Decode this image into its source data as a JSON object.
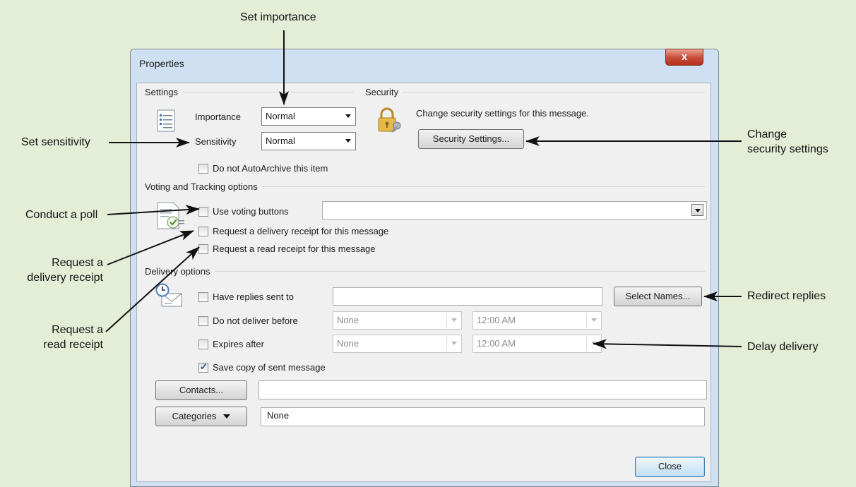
{
  "callouts": {
    "set_importance": "Set importance",
    "set_sensitivity": "Set sensitivity",
    "conduct_poll": "Conduct a poll",
    "request_delivery_1": "Request a",
    "request_delivery_2": "delivery receipt",
    "request_read_1": "Request a",
    "request_read_2": "read receipt",
    "change_security_1": "Change",
    "change_security_2": "security settings",
    "redirect_replies": "Redirect replies",
    "delay_delivery": "Delay delivery"
  },
  "dialog": {
    "title": "Properties",
    "close_glyph": "x"
  },
  "settings": {
    "group_label": "Settings",
    "importance_label": "Importance",
    "importance_value": "Normal",
    "sensitivity_label": "Sensitivity",
    "sensitivity_value": "Normal",
    "autoarchive_label": "Do not AutoArchive this item"
  },
  "security": {
    "group_label": "Security",
    "description": "Change security settings for this message.",
    "button_label": "Security Settings..."
  },
  "voting": {
    "group_label": "Voting and Tracking options",
    "use_voting_label": "Use voting buttons",
    "voting_value": "",
    "delivery_receipt_label": "Request a delivery receipt for this message",
    "read_receipt_label": "Request a read receipt for this message"
  },
  "delivery": {
    "group_label": "Delivery options",
    "have_replies_label": "Have replies sent to",
    "have_replies_value": "",
    "select_names_label": "Select Names...",
    "do_not_deliver_label": "Do not deliver before",
    "do_not_deliver_date": "None",
    "do_not_deliver_time": "12:00 AM",
    "expires_label": "Expires after",
    "expires_date": "None",
    "expires_time": "12:00 AM",
    "save_copy_label": "Save copy of sent message",
    "save_copy_checked": true
  },
  "contacts": {
    "button_label": "Contacts...",
    "value": ""
  },
  "categories": {
    "button_label": "Categories",
    "value": "None"
  },
  "footer": {
    "close_label": "Close"
  }
}
